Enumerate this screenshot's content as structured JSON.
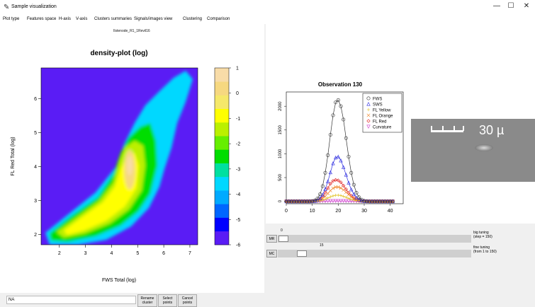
{
  "window": {
    "title": "Sample visualization",
    "minimize": "—",
    "maximize": "☐",
    "close": "✕"
  },
  "menu": [
    {
      "label": "Plot type"
    },
    {
      "label": "Features space"
    },
    {
      "label": "H-axis"
    },
    {
      "label": "V-axis"
    },
    {
      "label": "Clusters summaries"
    },
    {
      "label": "Signals/images view"
    },
    {
      "label": "Clustering"
    },
    {
      "label": "Comparison"
    }
  ],
  "sample_name": "Ilstenode_R1_1Revil16",
  "chart_data": [
    {
      "type": "heatmap",
      "title": "density-plot (log)",
      "xlabel": "FWS Total (log)",
      "ylabel": "FL Red Total (log)",
      "xlim": [
        1.3,
        7.3
      ],
      "ylim": [
        1.7,
        6.9
      ],
      "x_ticks": [
        "2",
        "3",
        "4",
        "5",
        "6",
        "7"
      ],
      "y_ticks": [
        "2",
        "3",
        "4",
        "5",
        "6"
      ],
      "colorbar": {
        "ticks": [
          "1",
          "0",
          "-1",
          "-2",
          "-3",
          "-4",
          "-5",
          "-6"
        ],
        "range": [
          -6,
          1
        ],
        "colors": [
          "#5a1cf5",
          "#0000ff",
          "#0066ff",
          "#00aaff",
          "#00d8ff",
          "#00e0a0",
          "#00dd00",
          "#66ee00",
          "#bbf000",
          "#ffff00",
          "#f5e86a",
          "#f6d880",
          "#f8dca8"
        ]
      },
      "background": "#5a1cf5"
    },
    {
      "type": "line",
      "title": "Observation 130",
      "x_ticks": [
        "0",
        "10",
        "20",
        "30",
        "40"
      ],
      "y_ticks": [
        "0",
        "500",
        "1000",
        "1500",
        "2000"
      ],
      "xlim": [
        0,
        45
      ],
      "ylim": [
        -50,
        2300
      ],
      "legend_position": "top-right",
      "series": [
        {
          "name": "FWS",
          "color": "#333333",
          "marker": "circle",
          "values": [
            0,
            0,
            0,
            0,
            0,
            0,
            0,
            0,
            0,
            2,
            6,
            20,
            60,
            150,
            320,
            600,
            970,
            1400,
            1810,
            2080,
            2130,
            2000,
            1720,
            1330,
            940,
            600,
            350,
            180,
            85,
            35,
            12,
            4,
            1,
            0,
            0,
            0,
            0,
            0,
            0,
            0,
            0,
            0
          ]
        },
        {
          "name": "SWS",
          "color": "#3030e0",
          "marker": "triangle",
          "values": [
            0,
            0,
            0,
            0,
            0,
            0,
            0,
            0,
            0,
            1,
            3,
            9,
            25,
            65,
            140,
            260,
            420,
            610,
            800,
            920,
            940,
            860,
            720,
            560,
            390,
            250,
            150,
            80,
            38,
            16,
            6,
            2,
            0,
            0,
            0,
            0,
            0,
            0,
            0,
            0,
            0,
            0
          ]
        },
        {
          "name": "FL Yellow",
          "color": "#e0c020",
          "marker": "plus",
          "values": [
            0,
            0,
            0,
            0,
            0,
            0,
            0,
            0,
            0,
            0,
            1,
            2,
            5,
            12,
            25,
            45,
            70,
            95,
            115,
            128,
            130,
            122,
            105,
            85,
            62,
            42,
            26,
            15,
            8,
            4,
            2,
            1,
            0,
            0,
            0,
            0,
            0,
            0,
            0,
            0,
            0,
            0
          ]
        },
        {
          "name": "FL Orange",
          "color": "#f08020",
          "marker": "x",
          "values": [
            0,
            0,
            0,
            0,
            0,
            0,
            0,
            0,
            0,
            0,
            2,
            5,
            12,
            30,
            60,
            105,
            165,
            225,
            275,
            300,
            300,
            280,
            240,
            190,
            140,
            95,
            60,
            35,
            18,
            8,
            3,
            1,
            0,
            0,
            0,
            0,
            0,
            0,
            0,
            0,
            0,
            0
          ]
        },
        {
          "name": "FL Red",
          "color": "#e02020",
          "marker": "diamond",
          "values": [
            0,
            0,
            0,
            0,
            0,
            0,
            0,
            0,
            0,
            1,
            3,
            8,
            20,
            50,
            100,
            180,
            280,
            370,
            430,
            450,
            440,
            400,
            330,
            255,
            180,
            120,
            72,
            40,
            20,
            9,
            3,
            1,
            0,
            0,
            0,
            0,
            0,
            0,
            0,
            0,
            0,
            0
          ]
        },
        {
          "name": "Curvature",
          "color": "#d040d0",
          "marker": "triangle-down",
          "values": [
            0,
            0,
            0,
            0,
            0,
            0,
            0,
            0,
            0,
            0,
            0,
            1,
            1,
            2,
            3,
            4,
            5,
            6,
            7,
            8,
            8,
            8,
            7,
            6,
            5,
            4,
            3,
            2,
            1,
            1,
            0,
            0,
            0,
            0,
            0,
            0,
            0,
            0,
            0,
            0,
            0,
            0
          ]
        }
      ]
    }
  ],
  "image": {
    "scale_text": "30 µ"
  },
  "sliders": [
    {
      "button": "MR",
      "value": "0",
      "label_line1": "big tuning",
      "label_line2": "(step = 150)",
      "position": 0.0
    },
    {
      "button": "MC",
      "value": "15",
      "label_line1": "fine tuning",
      "label_line2": "(from 1 to 150)",
      "position": 0.1
    }
  ],
  "bottom": {
    "input_value": "NA",
    "rename_l1": "Rename",
    "rename_l2": "cluster",
    "select_l1": "Select",
    "select_l2": "points",
    "cancel_l1": "Cancel",
    "cancel_l2": "points"
  }
}
